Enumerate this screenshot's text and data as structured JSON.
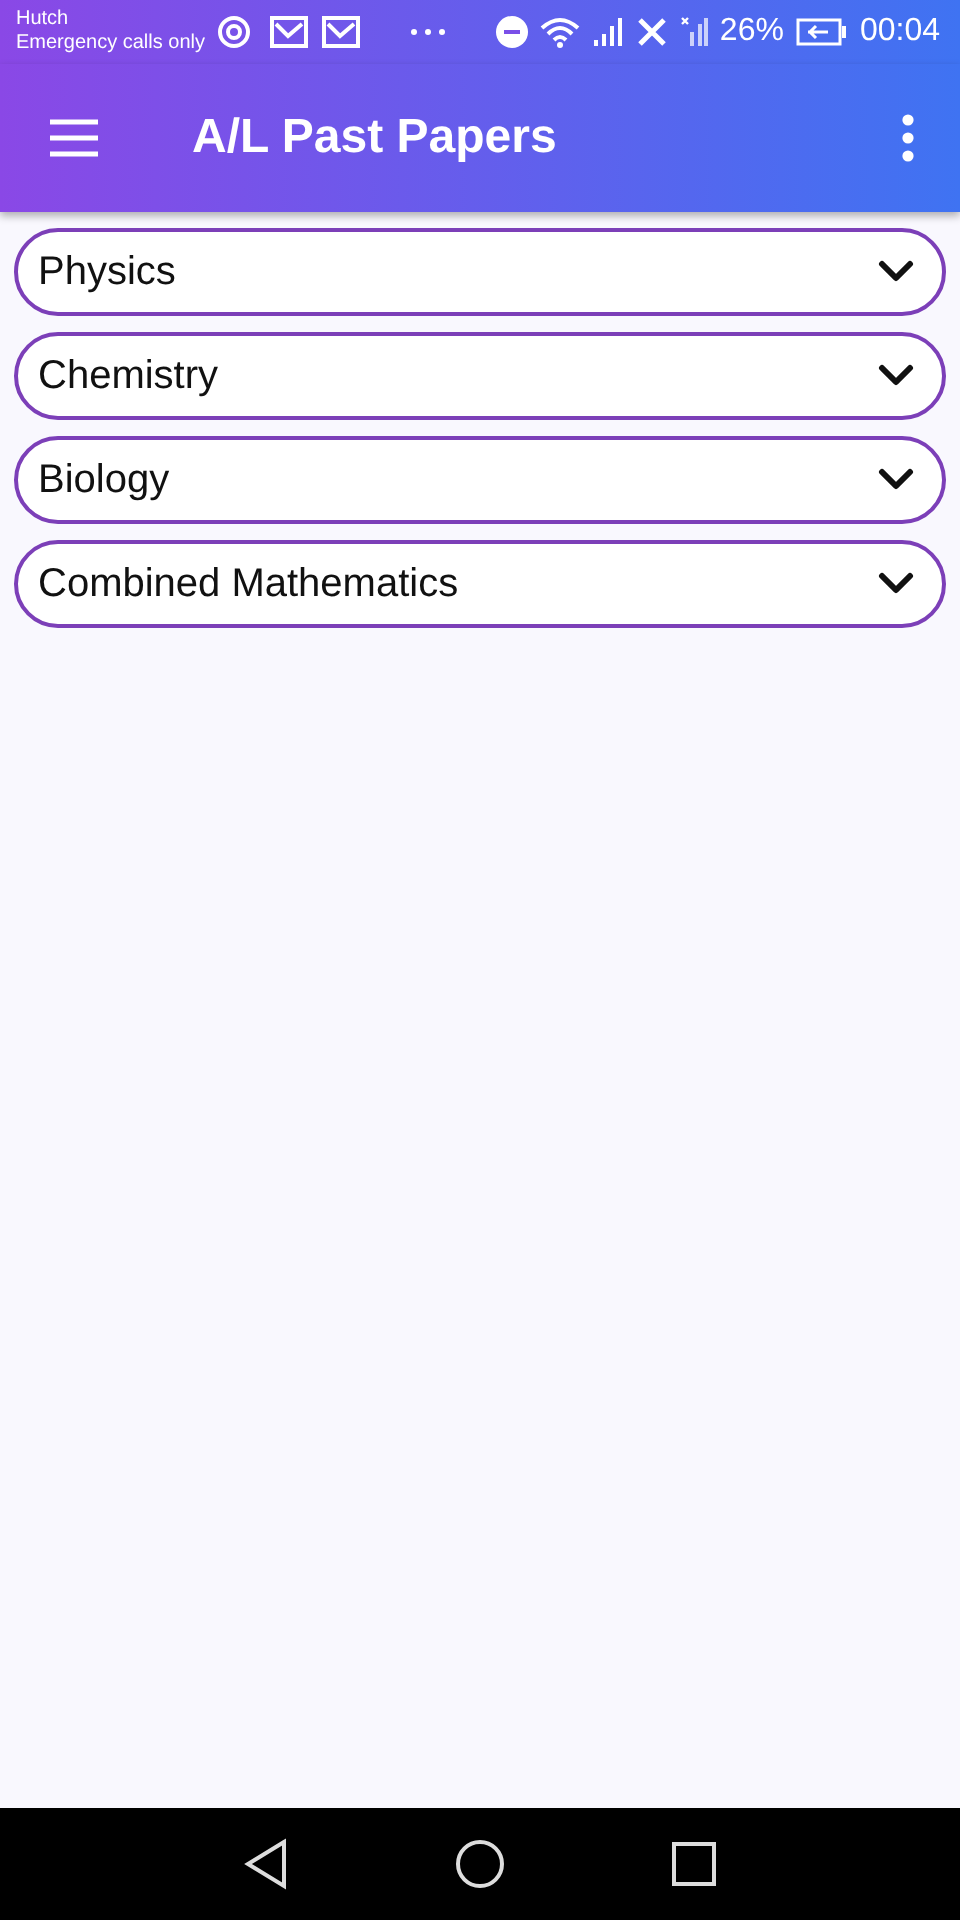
{
  "status_bar": {
    "carrier": "Hutch",
    "network_status": "Emergency calls only",
    "battery": "26%",
    "time": "00:04"
  },
  "app_bar": {
    "title": "A/L Past Papers"
  },
  "subjects": [
    {
      "label": "Physics",
      "expanded": false
    },
    {
      "label": "Chemistry",
      "expanded": false
    },
    {
      "label": "Biology",
      "expanded": false
    },
    {
      "label": "Combined Mathematics",
      "expanded": false
    }
  ]
}
